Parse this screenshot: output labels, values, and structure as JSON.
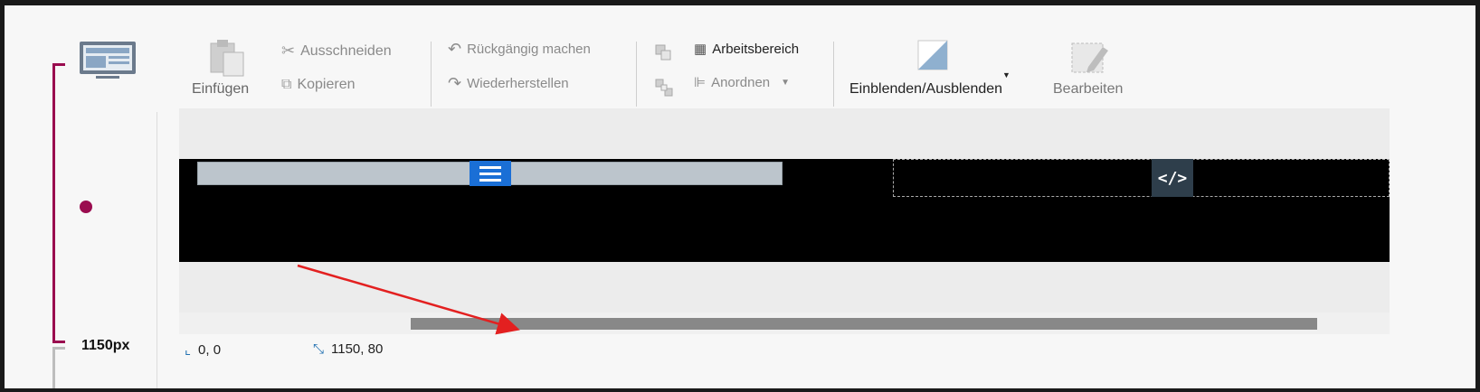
{
  "breakpoint": {
    "label": "1150px"
  },
  "ribbon": {
    "paste": "Einfügen",
    "cut": "Ausschneiden",
    "copy": "Kopieren",
    "undo": "Rückgängig machen",
    "redo": "Wiederherstellen",
    "workspace": "Arbeitsbereich",
    "arrange": "Anordnen",
    "showhide": "Einblenden/Ausblenden",
    "edit": "Bearbeiten"
  },
  "canvas": {
    "code_label": "</>"
  },
  "status": {
    "position": "0, 0",
    "size": "1150, 80"
  },
  "colors": {
    "accent": "#9a0c4f",
    "hamburger": "#1a6fd6",
    "arrow": "#e32020"
  }
}
